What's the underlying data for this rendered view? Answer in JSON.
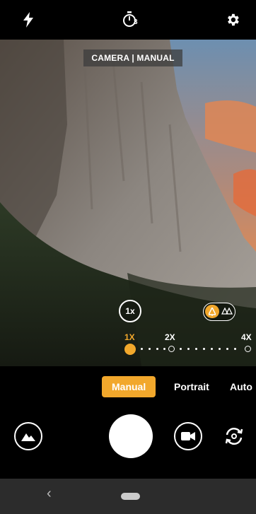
{
  "top_bar": {
    "flash_icon": "flash-icon",
    "timer_icon": "timer-3s-icon",
    "timer_badge": "3",
    "settings_icon": "gear-icon"
  },
  "viewfinder": {
    "mode_label": "CAMERA | MANUAL",
    "zoom_button": "1x",
    "lens_toggle": {
      "active": "single-tree-icon",
      "inactive": "multi-tree-icon"
    },
    "zoom_levels": [
      "1X",
      "2X",
      "4X"
    ],
    "zoom_active": "1X"
  },
  "modes": {
    "items": [
      "Manual",
      "Portrait",
      "Auto"
    ],
    "active": "Manual"
  },
  "controls": {
    "gallery_icon": "gallery-icon",
    "shutter": "shutter-button",
    "video_icon": "video-camera-icon",
    "switch_icon": "switch-camera-icon"
  },
  "navbar": {
    "back_glyph": "‹"
  },
  "colors": {
    "accent": "#f2a82c",
    "background": "#000000",
    "navbar": "#2c2c2c"
  }
}
